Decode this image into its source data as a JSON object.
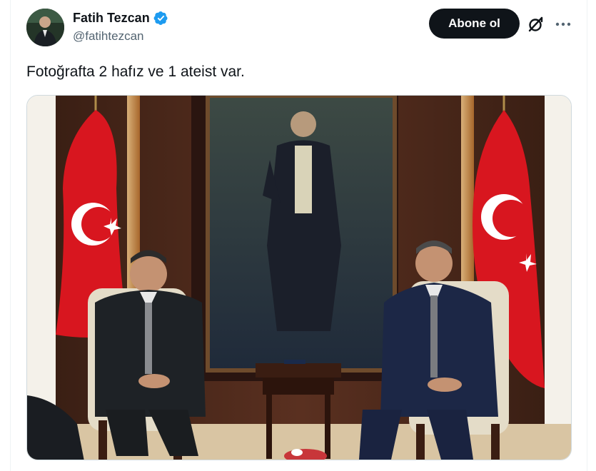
{
  "author": {
    "display_name": "Fatih Tezcan",
    "handle": "@fatihtezcan",
    "verified": true,
    "avatar_icon": "user-avatar"
  },
  "actions": {
    "follow_label": "Abone ol",
    "grok_icon": "grok-icon",
    "more_icon": "more-dots-icon"
  },
  "tweet": {
    "text": "Fotoğrafta 2 hafız ve 1 ateist var."
  },
  "media": {
    "type": "photo"
  },
  "colors": {
    "text_primary": "#0f1419",
    "text_secondary": "#536471",
    "verified_blue": "#1d9bf0",
    "flag_red": "#e30a17"
  }
}
